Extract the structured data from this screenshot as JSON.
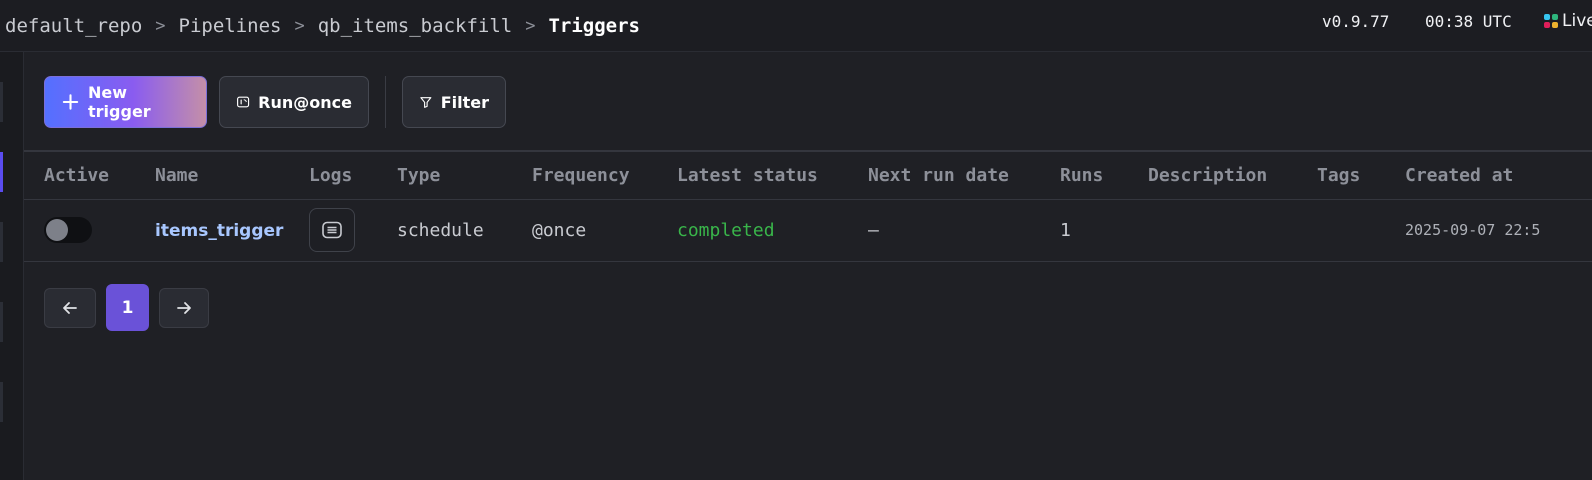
{
  "header": {
    "breadcrumbs": [
      "default_repo",
      "Pipelines",
      "qb_items_backfill",
      "Triggers"
    ],
    "version": "v0.9.77",
    "time": "00:38 UTC",
    "live_label": "Live"
  },
  "toolbar": {
    "new_trigger_label": "New trigger",
    "run_once_label": "Run@once",
    "filter_label": "Filter"
  },
  "table": {
    "columns": [
      "Active",
      "Name",
      "Logs",
      "Type",
      "Frequency",
      "Latest status",
      "Next run date",
      "Runs",
      "Description",
      "Tags",
      "Created at"
    ],
    "rows": [
      {
        "active": false,
        "name": "items_trigger",
        "type": "schedule",
        "frequency": "@once",
        "latest_status": "completed",
        "next_run_date": "–",
        "runs": "1",
        "description": "",
        "tags": "",
        "created_at": "2025-09-07 22:5"
      }
    ]
  },
  "pagination": {
    "current_page": "1",
    "prev_icon": "arrow-left-icon",
    "next_icon": "arrow-right-icon"
  },
  "colors": {
    "accent": "#6a52d8",
    "status_completed": "#39b54a",
    "link": "#a8c7ff"
  }
}
